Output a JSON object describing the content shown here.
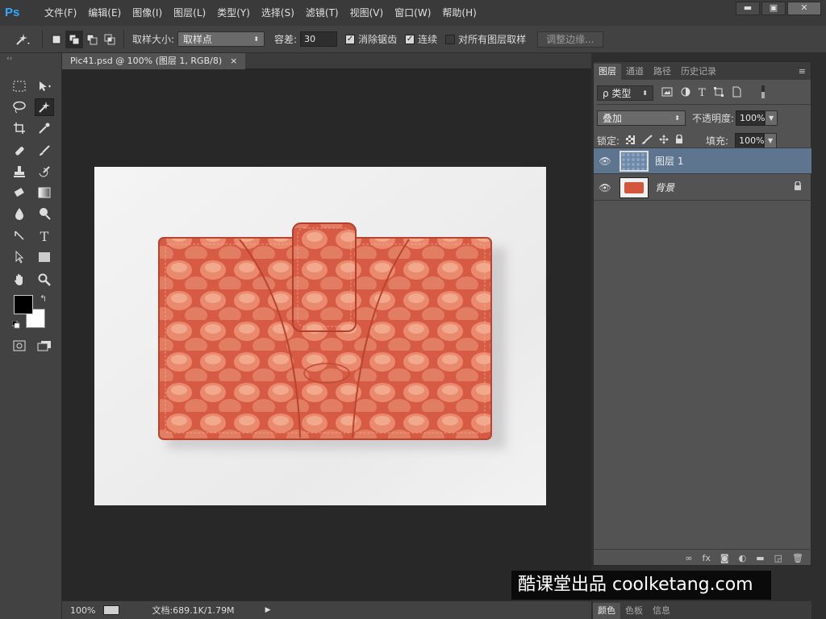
{
  "app": {
    "logo": "Ps"
  },
  "menu": [
    "文件(F)",
    "编辑(E)",
    "图像(I)",
    "图层(L)",
    "类型(Y)",
    "选择(S)",
    "滤镜(T)",
    "视图(V)",
    "窗口(W)",
    "帮助(H)"
  ],
  "window_controls": {
    "minimize": "▬",
    "maximize": "▣",
    "close": "✕"
  },
  "options": {
    "sample_size_label": "取样大小:",
    "sample_size_value": "取样点",
    "tolerance_label": "容差:",
    "tolerance_value": "30",
    "antialias_label": "消除锯齿",
    "contiguous_label": "连续",
    "sample_all_label": "对所有图层取样",
    "refine_edge_label": "调整边缘..."
  },
  "document": {
    "tab_title": "Pic41.psd @ 100% (图层 1, RGB/8)",
    "tab_close": "×",
    "zoom": "100%",
    "doc_info": "文档:689.1K/1.79M"
  },
  "panels": {
    "tabs": [
      "图层",
      "通道",
      "路径",
      "历史记录"
    ],
    "filter_kind": "ρ 类型",
    "blend_mode": "叠加",
    "opacity_label": "不透明度:",
    "opacity_value": "100%",
    "lock_label": "锁定:",
    "fill_label": "填充:",
    "fill_value": "100%",
    "layers": [
      {
        "name": "图层 1",
        "selected": true
      },
      {
        "name": "背景",
        "selected": false,
        "locked": true
      }
    ],
    "bottom_tabs": [
      "颜色",
      "色板",
      "信息"
    ]
  },
  "watermark": "酷课堂出品 coolketang.com",
  "colors": {
    "accent": "#31a8ff",
    "selected_layer": "#5e7590",
    "wallet": "#d4553e"
  }
}
